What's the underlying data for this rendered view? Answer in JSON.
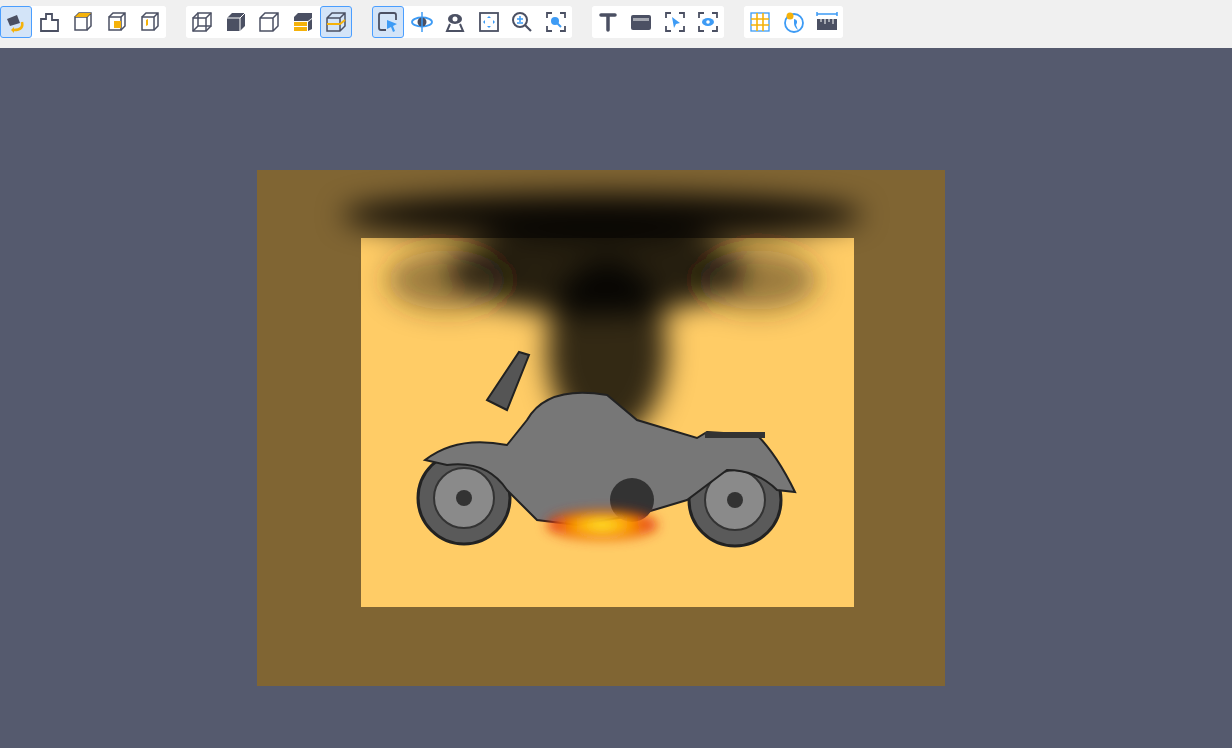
{
  "toolbar": {
    "groups": [
      {
        "buttons": [
          {
            "selected": true
          },
          {
            "selected": false
          },
          {
            "selected": false
          },
          {
            "selected": false
          },
          {
            "selected": false
          }
        ]
      },
      {
        "buttons": [
          {
            "selected": false
          },
          {
            "selected": false
          },
          {
            "selected": false
          },
          {
            "selected": false
          },
          {
            "selected": true
          }
        ]
      },
      {
        "buttons": [
          {
            "selected": true
          },
          {
            "selected": false
          },
          {
            "selected": false
          },
          {
            "selected": false
          },
          {
            "selected": false
          },
          {
            "selected": false
          }
        ]
      },
      {
        "buttons": [
          {
            "selected": false
          },
          {
            "selected": false
          },
          {
            "selected": false
          },
          {
            "selected": false
          }
        ]
      },
      {
        "buttons": [
          {
            "selected": false
          },
          {
            "selected": false
          },
          {
            "selected": false
          }
        ]
      }
    ]
  }
}
